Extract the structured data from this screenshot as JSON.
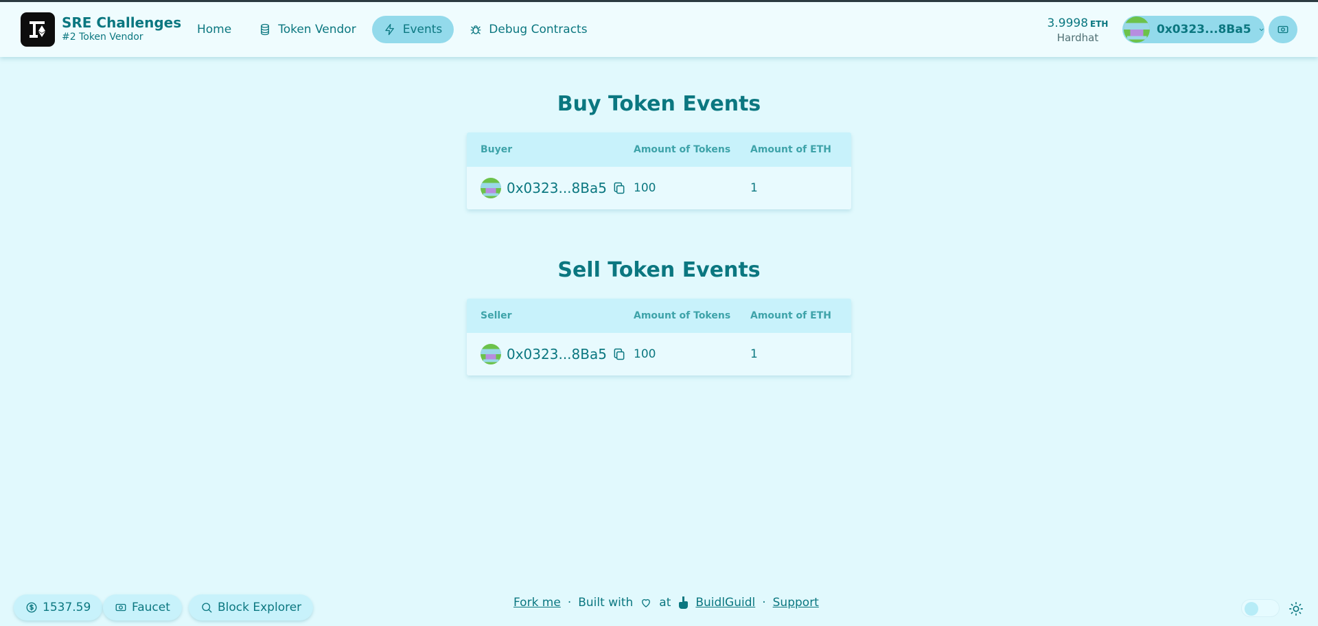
{
  "header": {
    "brand_title": "SRE Challenges",
    "brand_subtitle": "#2 Token Vendor",
    "nav": [
      {
        "label": "Home",
        "icon": "none",
        "active": false
      },
      {
        "label": "Token Vendor",
        "icon": "coins-icon",
        "active": false
      },
      {
        "label": "Events",
        "icon": "bolt-icon",
        "active": true
      },
      {
        "label": "Debug Contracts",
        "icon": "bug-icon",
        "active": false
      }
    ],
    "balance_value": "3.9998",
    "balance_unit": "ETH",
    "network": "Hardhat",
    "account_label": "0x0323...8Ba5"
  },
  "buy_section": {
    "title": "Buy Token Events",
    "columns": [
      "Buyer",
      "Amount of Tokens",
      "Amount of ETH"
    ],
    "rows": [
      {
        "address": "0x0323...8Ba5",
        "tokens": "100",
        "eth": "1"
      }
    ]
  },
  "sell_section": {
    "title": "Sell Token Events",
    "columns": [
      "Seller",
      "Amount of Tokens",
      "Amount of ETH"
    ],
    "rows": [
      {
        "address": "0x0323...8Ba5",
        "tokens": "100",
        "eth": "1"
      }
    ]
  },
  "footer": {
    "price": "1537.59",
    "faucet": "Faucet",
    "block_explorer": "Block Explorer",
    "fork_me": "Fork me",
    "sep": "·",
    "built_with": "Built with",
    "at": "at",
    "buidlguidl": "BuidlGuidl",
    "support": "Support"
  },
  "colors": {
    "background": "#e1f9fd",
    "header_bg": "#effcfe",
    "accent": "#93daeb",
    "text": "#0b7780"
  }
}
